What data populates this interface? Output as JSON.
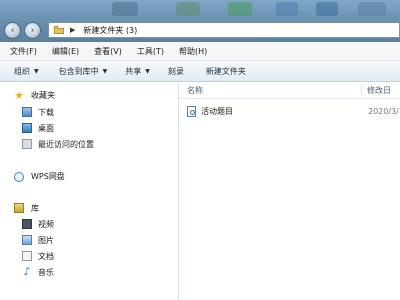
{
  "window": {
    "address_path": "新建文件夹 (3)"
  },
  "menu": [
    "文件(F)",
    "编辑(E)",
    "查看(V)",
    "工具(T)",
    "帮助(H)"
  ],
  "toolbar": {
    "organize": "组织",
    "include_in_library": "包含到库中",
    "share": "共享",
    "burn": "刻录",
    "new_folder": "新建文件夹"
  },
  "navpane": {
    "favorites": "收藏夹",
    "downloads": "下载",
    "desktop": "桌面",
    "recent": "最近访问的位置",
    "wps_cloud": "WPS网盘",
    "libraries": "库",
    "videos": "视频",
    "pictures": "图片",
    "documents": "文档",
    "music": "音乐"
  },
  "columns": {
    "name": "名称",
    "date": "修改日"
  },
  "files": [
    {
      "name": "活动题目",
      "date": "2020/3/"
    }
  ],
  "icons": {
    "back": "back-arrow-icon",
    "forward": "forward-arrow-icon",
    "favorites": "star-icon",
    "cloud": "cloud-icon"
  }
}
